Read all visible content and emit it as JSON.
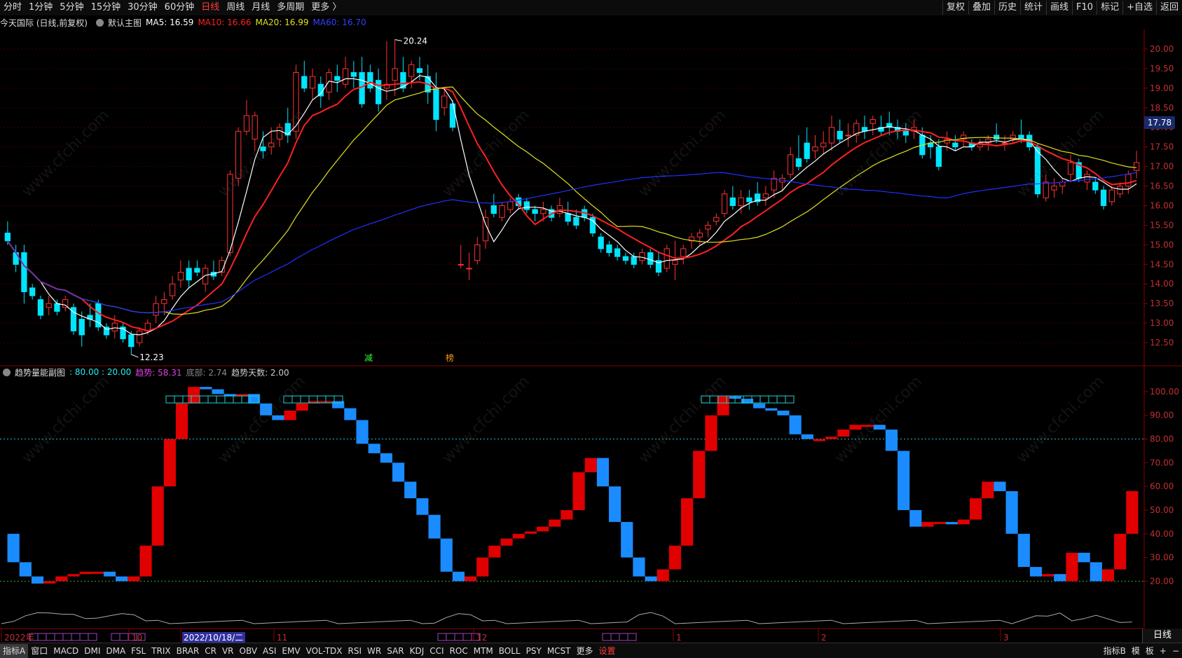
{
  "toolbar": {
    "left": [
      "分时",
      "1分钟",
      "5分钟",
      "15分钟",
      "30分钟",
      "60分钟",
      "日线",
      "周线",
      "月线",
      "多周期",
      "更多 〉"
    ],
    "active_index": 6,
    "right": [
      "复权",
      "叠加",
      "历史",
      "统计",
      "画线",
      "F10",
      "标记",
      "+自选",
      "返回"
    ]
  },
  "info": {
    "stock": "今天国际 (日线,前复权)",
    "template": "默认主图",
    "ma5": "MA5: 16.59",
    "ma10": "MA10: 16.66",
    "ma20": "MA20: 16.99",
    "ma60": "MA60: 16.70"
  },
  "sub_info": {
    "name": "趋势量能副图",
    "levels": ": 80.00 : 20.00",
    "trend": "趋势: 58.31",
    "bottom": "底部: 2.74",
    "days": "趋势天数: 2.00"
  },
  "colors": {
    "up": "#ff3232",
    "down": "#00e5ff",
    "ma5": "#ffffff",
    "ma10": "#ff2020",
    "ma20": "#e0e020",
    "ma60": "#2030ff",
    "sub_up": "#e00000",
    "sub_down": "#1a8cff"
  },
  "chart_data": {
    "type": "candlestick",
    "ylim": [
      12.0,
      20.5
    ],
    "yticks": [
      "20.00",
      "19.50",
      "19.00",
      "18.50",
      "18.00",
      "17.50",
      "17.00",
      "16.50",
      "16.00",
      "15.50",
      "15.00",
      "14.50",
      "14.00",
      "13.50",
      "13.00",
      "12.50"
    ],
    "current_price": "17.78",
    "annotations": {
      "high": "20.24",
      "low": "12.23",
      "mark_red": "减",
      "mark_orange": "榜"
    },
    "x_labels": [
      "2022年",
      "10",
      "2022/10/18/二",
      "11",
      "12",
      "1",
      "2",
      "3"
    ],
    "candles": [
      [
        15.3,
        15.6,
        15.0,
        15.1
      ],
      [
        14.8,
        15.0,
        14.3,
        14.5
      ],
      [
        14.8,
        15.0,
        13.5,
        13.8
      ],
      [
        13.9,
        14.0,
        13.6,
        13.7
      ],
      [
        13.6,
        13.7,
        13.1,
        13.2
      ],
      [
        13.4,
        13.7,
        13.2,
        13.5
      ],
      [
        13.5,
        13.6,
        13.2,
        13.3
      ],
      [
        13.4,
        13.7,
        13.3,
        13.6
      ],
      [
        13.4,
        13.5,
        12.7,
        12.8
      ],
      [
        13.1,
        13.3,
        12.4,
        12.7
      ],
      [
        13.2,
        13.5,
        12.9,
        13.1
      ],
      [
        13.5,
        13.6,
        12.8,
        12.9
      ],
      [
        12.9,
        13.0,
        12.6,
        12.7
      ],
      [
        12.8,
        13.2,
        12.6,
        13.0
      ],
      [
        12.9,
        13.0,
        12.5,
        12.6
      ],
      [
        12.7,
        12.8,
        12.2,
        12.4
      ],
      [
        12.5,
        12.9,
        12.4,
        12.8
      ],
      [
        12.8,
        13.1,
        12.7,
        13.0
      ],
      [
        13.2,
        13.7,
        13.0,
        13.5
      ],
      [
        13.5,
        13.8,
        13.2,
        13.6
      ],
      [
        13.7,
        14.2,
        13.6,
        14.0
      ],
      [
        14.1,
        14.6,
        13.9,
        14.3
      ],
      [
        14.4,
        14.6,
        13.9,
        14.1
      ],
      [
        14.4,
        14.6,
        14.2,
        14.3
      ],
      [
        14.0,
        14.5,
        13.8,
        14.4
      ],
      [
        14.3,
        14.6,
        14.1,
        14.2
      ],
      [
        14.3,
        14.7,
        14.2,
        14.6
      ],
      [
        14.8,
        16.9,
        14.7,
        16.8
      ],
      [
        16.7,
        18.0,
        16.5,
        17.9
      ],
      [
        17.9,
        18.7,
        17.8,
        18.3
      ],
      [
        17.7,
        18.4,
        17.4,
        18.3
      ],
      [
        17.5,
        17.9,
        17.2,
        17.4
      ],
      [
        17.5,
        18.0,
        17.3,
        17.6
      ],
      [
        17.7,
        18.1,
        17.5,
        18.0
      ],
      [
        18.1,
        18.5,
        17.6,
        17.8
      ],
      [
        17.9,
        19.6,
        17.7,
        19.4
      ],
      [
        19.3,
        19.7,
        18.9,
        19.0
      ],
      [
        19.0,
        19.5,
        18.7,
        19.3
      ],
      [
        19.1,
        19.3,
        18.5,
        18.8
      ],
      [
        18.9,
        19.5,
        18.7,
        19.4
      ],
      [
        19.3,
        19.6,
        18.9,
        19.2
      ],
      [
        19.1,
        19.8,
        19.0,
        19.5
      ],
      [
        19.4,
        19.7,
        19.0,
        19.3
      ],
      [
        19.4,
        19.8,
        18.5,
        18.6
      ],
      [
        19.4,
        19.6,
        18.9,
        19.0
      ],
      [
        19.2,
        19.5,
        18.4,
        18.6
      ],
      [
        19.0,
        20.2,
        18.7,
        19.1
      ],
      [
        19.2,
        20.24,
        18.8,
        19.5
      ],
      [
        19.4,
        19.8,
        18.9,
        19.0
      ],
      [
        19.3,
        19.7,
        19.0,
        19.6
      ],
      [
        19.5,
        19.8,
        19.2,
        19.4
      ],
      [
        19.3,
        19.6,
        18.6,
        18.9
      ],
      [
        19.0,
        19.4,
        17.9,
        18.2
      ],
      [
        18.5,
        19.0,
        18.3,
        18.8
      ],
      [
        18.6,
        18.7,
        17.9,
        18.0
      ],
      [
        14.5,
        15.0,
        14.4,
        14.5
      ],
      [
        14.4,
        14.8,
        14.1,
        14.4
      ],
      [
        14.6,
        15.2,
        14.5,
        15.0
      ],
      [
        15.1,
        15.9,
        14.9,
        15.7
      ],
      [
        16.0,
        16.3,
        15.7,
        15.8
      ],
      [
        15.7,
        16.1,
        15.6,
        16.0
      ],
      [
        15.9,
        16.2,
        15.8,
        16.1
      ],
      [
        16.2,
        16.3,
        15.9,
        16.0
      ],
      [
        16.1,
        16.2,
        15.8,
        15.9
      ],
      [
        15.9,
        16.0,
        15.6,
        15.8
      ],
      [
        15.8,
        16.1,
        15.6,
        15.9
      ],
      [
        15.9,
        16.0,
        15.6,
        15.7
      ],
      [
        15.8,
        16.2,
        15.7,
        16.0
      ],
      [
        15.8,
        16.1,
        15.5,
        15.6
      ],
      [
        15.7,
        15.9,
        15.4,
        15.5
      ],
      [
        15.9,
        16.0,
        15.6,
        15.7
      ],
      [
        15.7,
        15.8,
        15.2,
        15.3
      ],
      [
        15.2,
        15.3,
        14.8,
        14.9
      ],
      [
        15.0,
        15.1,
        14.7,
        14.8
      ],
      [
        14.9,
        15.0,
        14.6,
        14.7
      ],
      [
        14.7,
        14.8,
        14.5,
        14.6
      ],
      [
        14.7,
        14.8,
        14.4,
        14.5
      ],
      [
        14.6,
        14.9,
        14.5,
        14.8
      ],
      [
        14.8,
        14.9,
        14.4,
        14.5
      ],
      [
        14.6,
        14.8,
        14.2,
        14.3
      ],
      [
        14.4,
        15.0,
        14.3,
        14.9
      ],
      [
        14.5,
        15.1,
        14.1,
        14.6
      ],
      [
        14.7,
        15.0,
        14.5,
        14.9
      ],
      [
        15.1,
        15.3,
        14.9,
        15.2
      ],
      [
        15.2,
        15.4,
        15.0,
        15.3
      ],
      [
        15.4,
        15.6,
        15.2,
        15.5
      ],
      [
        15.6,
        15.8,
        15.5,
        15.7
      ],
      [
        15.8,
        16.4,
        15.7,
        16.3
      ],
      [
        16.2,
        16.5,
        15.9,
        16.0
      ],
      [
        16.0,
        16.4,
        15.8,
        16.2
      ],
      [
        16.2,
        16.4,
        15.9,
        16.1
      ],
      [
        16.3,
        16.6,
        16.0,
        16.1
      ],
      [
        16.2,
        16.5,
        16.0,
        16.3
      ],
      [
        16.4,
        16.9,
        16.2,
        16.7
      ],
      [
        16.6,
        16.8,
        16.4,
        16.7
      ],
      [
        16.8,
        17.5,
        16.7,
        17.3
      ],
      [
        17.2,
        17.8,
        16.9,
        17.0
      ],
      [
        17.6,
        18.0,
        17.1,
        17.2
      ],
      [
        17.4,
        17.8,
        17.2,
        17.5
      ],
      [
        17.5,
        17.9,
        17.3,
        17.6
      ],
      [
        17.6,
        18.3,
        17.4,
        18.0
      ],
      [
        17.9,
        18.2,
        17.6,
        17.7
      ],
      [
        17.8,
        18.1,
        17.5,
        17.8
      ],
      [
        17.8,
        18.2,
        17.6,
        18.1
      ],
      [
        18.0,
        18.3,
        17.7,
        17.9
      ],
      [
        18.1,
        18.3,
        17.8,
        18.2
      ],
      [
        18.0,
        18.3,
        17.8,
        17.9
      ],
      [
        18.1,
        18.4,
        17.8,
        18.0
      ],
      [
        18.0,
        18.2,
        17.7,
        17.9
      ],
      [
        17.9,
        18.1,
        17.6,
        17.8
      ],
      [
        17.9,
        18.2,
        17.7,
        18.0
      ],
      [
        17.8,
        18.0,
        17.2,
        17.3
      ],
      [
        17.6,
        17.8,
        17.2,
        17.5
      ],
      [
        17.5,
        17.7,
        16.9,
        17.0
      ],
      [
        17.6,
        17.9,
        17.4,
        17.7
      ],
      [
        17.6,
        17.8,
        17.4,
        17.5
      ],
      [
        17.7,
        17.9,
        17.5,
        17.8
      ],
      [
        17.6,
        17.7,
        17.4,
        17.5
      ],
      [
        17.5,
        17.7,
        17.4,
        17.6
      ],
      [
        17.6,
        17.8,
        17.4,
        17.7
      ],
      [
        17.8,
        18.1,
        17.6,
        17.7
      ],
      [
        17.6,
        17.8,
        17.4,
        17.6
      ],
      [
        17.7,
        17.9,
        17.6,
        17.8
      ],
      [
        17.8,
        18.2,
        17.6,
        17.7
      ],
      [
        17.8,
        17.9,
        17.4,
        17.5
      ],
      [
        17.5,
        17.6,
        16.2,
        16.3
      ],
      [
        16.2,
        16.8,
        16.1,
        16.6
      ],
      [
        16.4,
        16.7,
        16.2,
        16.5
      ],
      [
        16.5,
        16.7,
        16.3,
        16.6
      ],
      [
        16.8,
        17.3,
        16.6,
        17.1
      ],
      [
        17.1,
        17.2,
        16.6,
        16.7
      ],
      [
        16.6,
        16.9,
        16.4,
        16.8
      ],
      [
        16.6,
        16.7,
        16.3,
        16.4
      ],
      [
        16.4,
        16.5,
        15.9,
        16.0
      ],
      [
        16.1,
        16.5,
        16.0,
        16.4
      ],
      [
        16.3,
        16.6,
        16.2,
        16.5
      ],
      [
        16.5,
        16.9,
        16.3,
        16.8
      ],
      [
        16.9,
        17.4,
        16.7,
        17.1
      ]
    ],
    "sub_ylim": [
      0,
      105
    ],
    "sub_yticks": [
      "100.00",
      "90.00",
      "80.00",
      "70.00",
      "60.00",
      "50.00",
      "40.00",
      "30.00",
      "20.00"
    ],
    "sub_trend": [
      40,
      28,
      22,
      19,
      20,
      22,
      23,
      24,
      24,
      22,
      20,
      22,
      35,
      60,
      80,
      95,
      102,
      101,
      99,
      98,
      99,
      95,
      90,
      88,
      92,
      95,
      96,
      96,
      93,
      88,
      78,
      74,
      70,
      62,
      55,
      48,
      38,
      24,
      20,
      22,
      30,
      35,
      38,
      40,
      41,
      43,
      46,
      50,
      66,
      72,
      60,
      45,
      30,
      22,
      20,
      25,
      35,
      55,
      75,
      90,
      98,
      97,
      95,
      93,
      92,
      90,
      82,
      80,
      80,
      81,
      84,
      86,
      86,
      84,
      75,
      50,
      43,
      45,
      45,
      44,
      46,
      55,
      62,
      58,
      40,
      26,
      22,
      23,
      20,
      32,
      28,
      20,
      25,
      40,
      58
    ]
  },
  "bottom_bar": {
    "left": [
      "指标A",
      "窗口",
      "MACD",
      "DMI",
      "DMA",
      "FSL",
      "TRIX",
      "BRAR",
      "CR",
      "VR",
      "OBV",
      "ASI",
      "EMV",
      "VOL-TDX",
      "RSI",
      "WR",
      "SAR",
      "KDJ",
      "CCI",
      "ROC",
      "MTM",
      "BOLL",
      "PSY",
      "MCST",
      "更多",
      "设置"
    ],
    "right": [
      "指标B",
      "模",
      "板",
      "+",
      "−"
    ],
    "day_tab": "日线"
  }
}
